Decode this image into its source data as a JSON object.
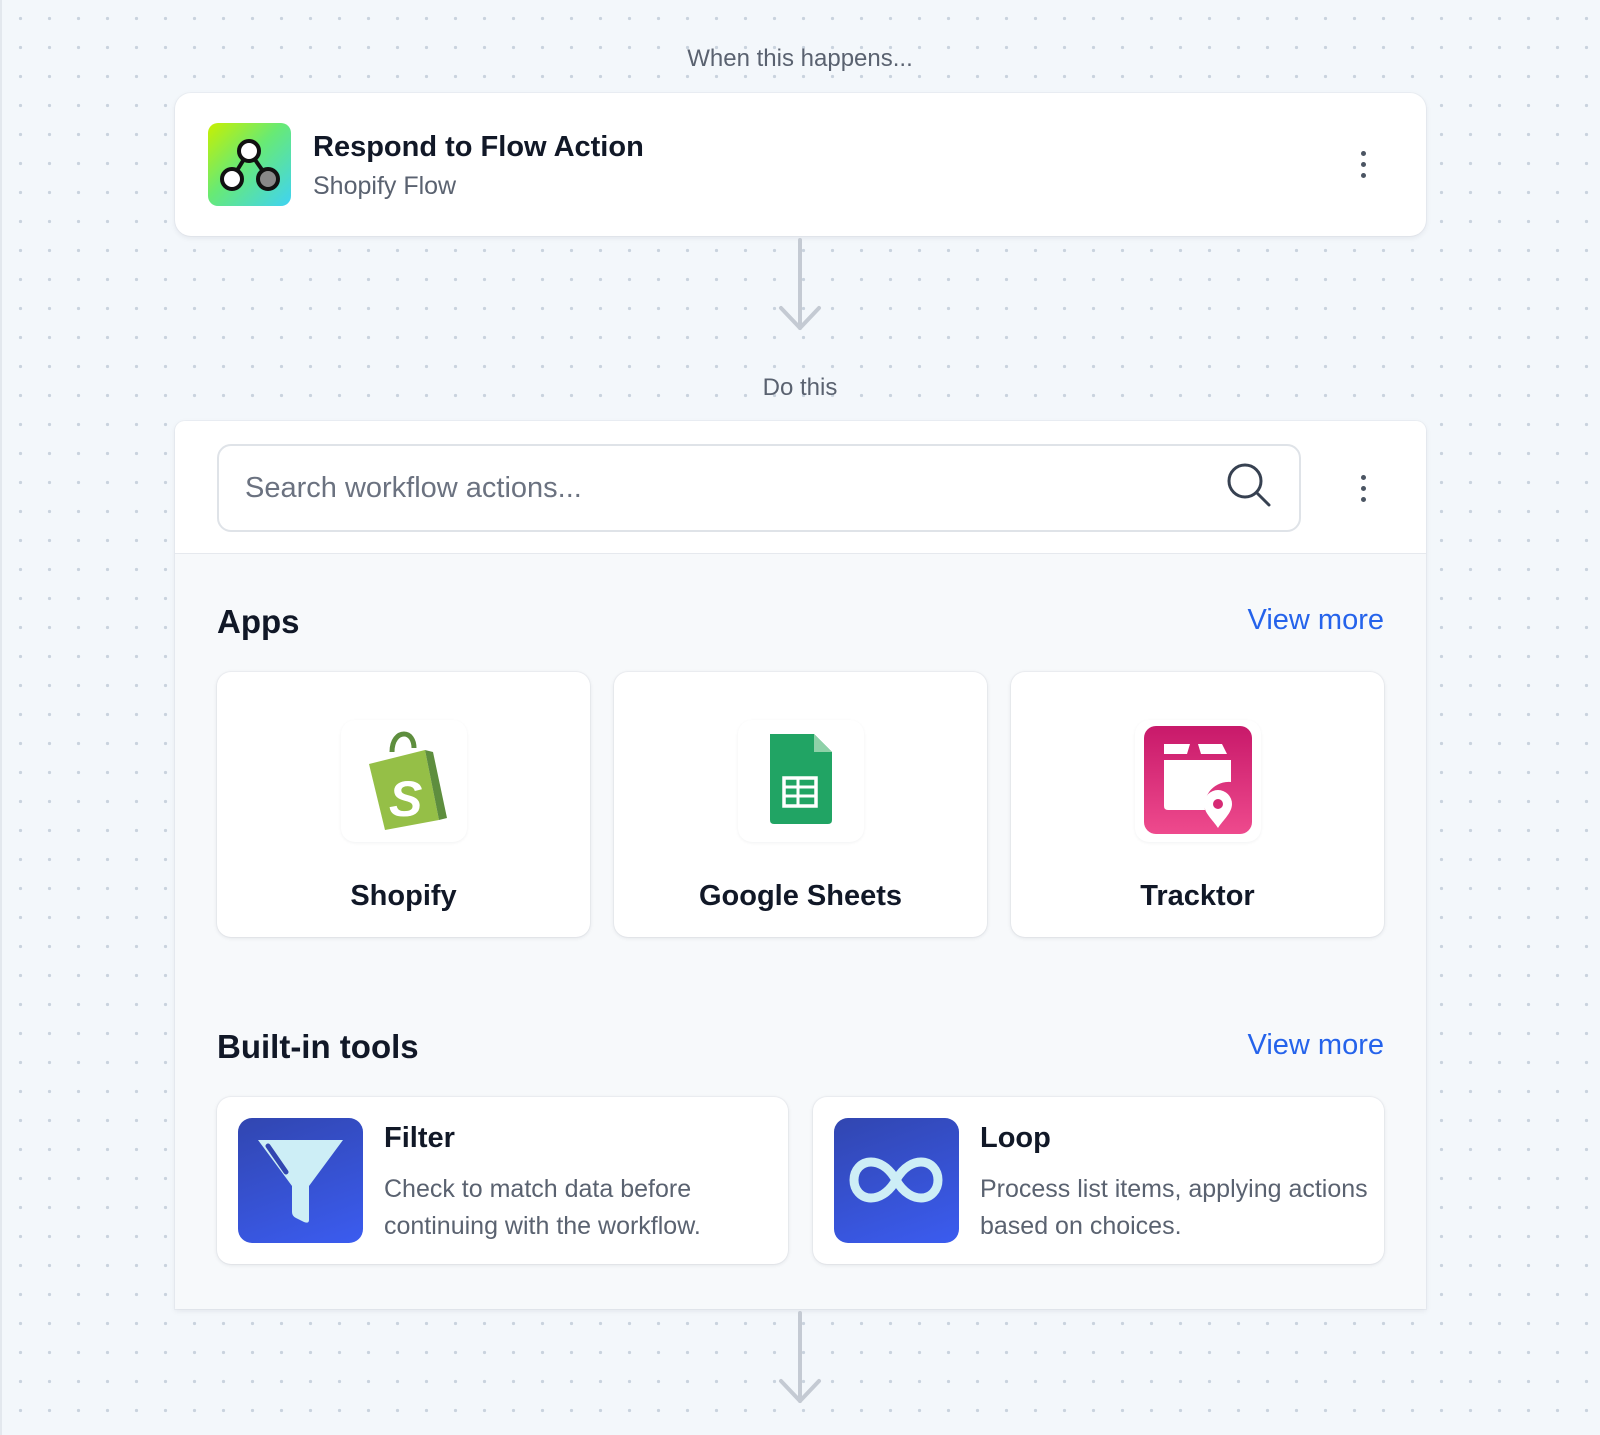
{
  "trigger": {
    "section_label": "When this happens...",
    "title": "Respond to Flow Action",
    "subtitle": "Shopify Flow",
    "icon": "shopify-flow-icon"
  },
  "action": {
    "section_label": "Do this",
    "search": {
      "placeholder": "Search workflow actions...",
      "value": ""
    },
    "apps": {
      "title": "Apps",
      "view_more": "View more",
      "items": [
        {
          "label": "Shopify",
          "icon": "shopify-bag-icon"
        },
        {
          "label": "Google Sheets",
          "icon": "google-sheets-icon"
        },
        {
          "label": "Tracktor",
          "icon": "tracktor-icon"
        }
      ]
    },
    "tools": {
      "title": "Built-in tools",
      "view_more": "View more",
      "items": [
        {
          "name": "Filter",
          "description": "Check to match data before continuing with the workflow.",
          "icon": "funnel-icon"
        },
        {
          "name": "Loop",
          "description": "Process list items, applying actions based on choices.",
          "icon": "infinity-icon"
        }
      ]
    }
  },
  "colors": {
    "accent_link": "#2563eb",
    "tool_icon_bg": "#3b5cf0",
    "tracktor_pink": "#e0367a",
    "shopify_green": "#95bf47",
    "sheets_green": "#21a464"
  }
}
